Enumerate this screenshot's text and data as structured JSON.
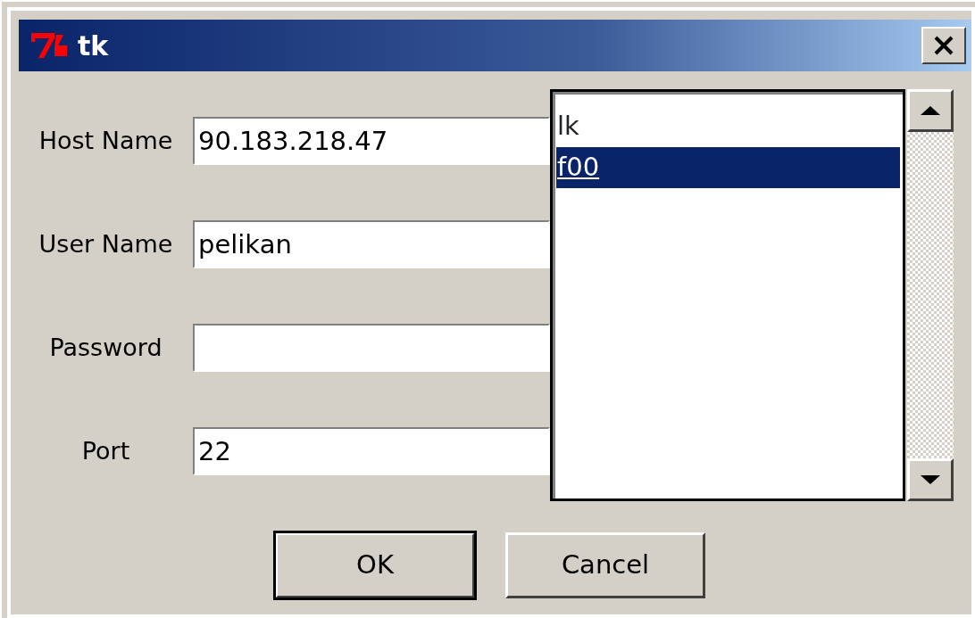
{
  "window": {
    "title": "tk"
  },
  "fields": [
    {
      "label": "Host Name",
      "value": "90.183.218.47"
    },
    {
      "label": "User Name",
      "value": "pelikan"
    },
    {
      "label": "Password"
    },
    {
      "label": "Port",
      "value": "22"
    }
  ],
  "list": {
    "items": [
      {
        "text": "lk",
        "selected": false
      },
      {
        "text": "f00",
        "selected": true
      }
    ]
  },
  "buttons": [
    {
      "label": "OK",
      "default": true
    },
    {
      "label": "Cancel",
      "default": false
    }
  ]
}
